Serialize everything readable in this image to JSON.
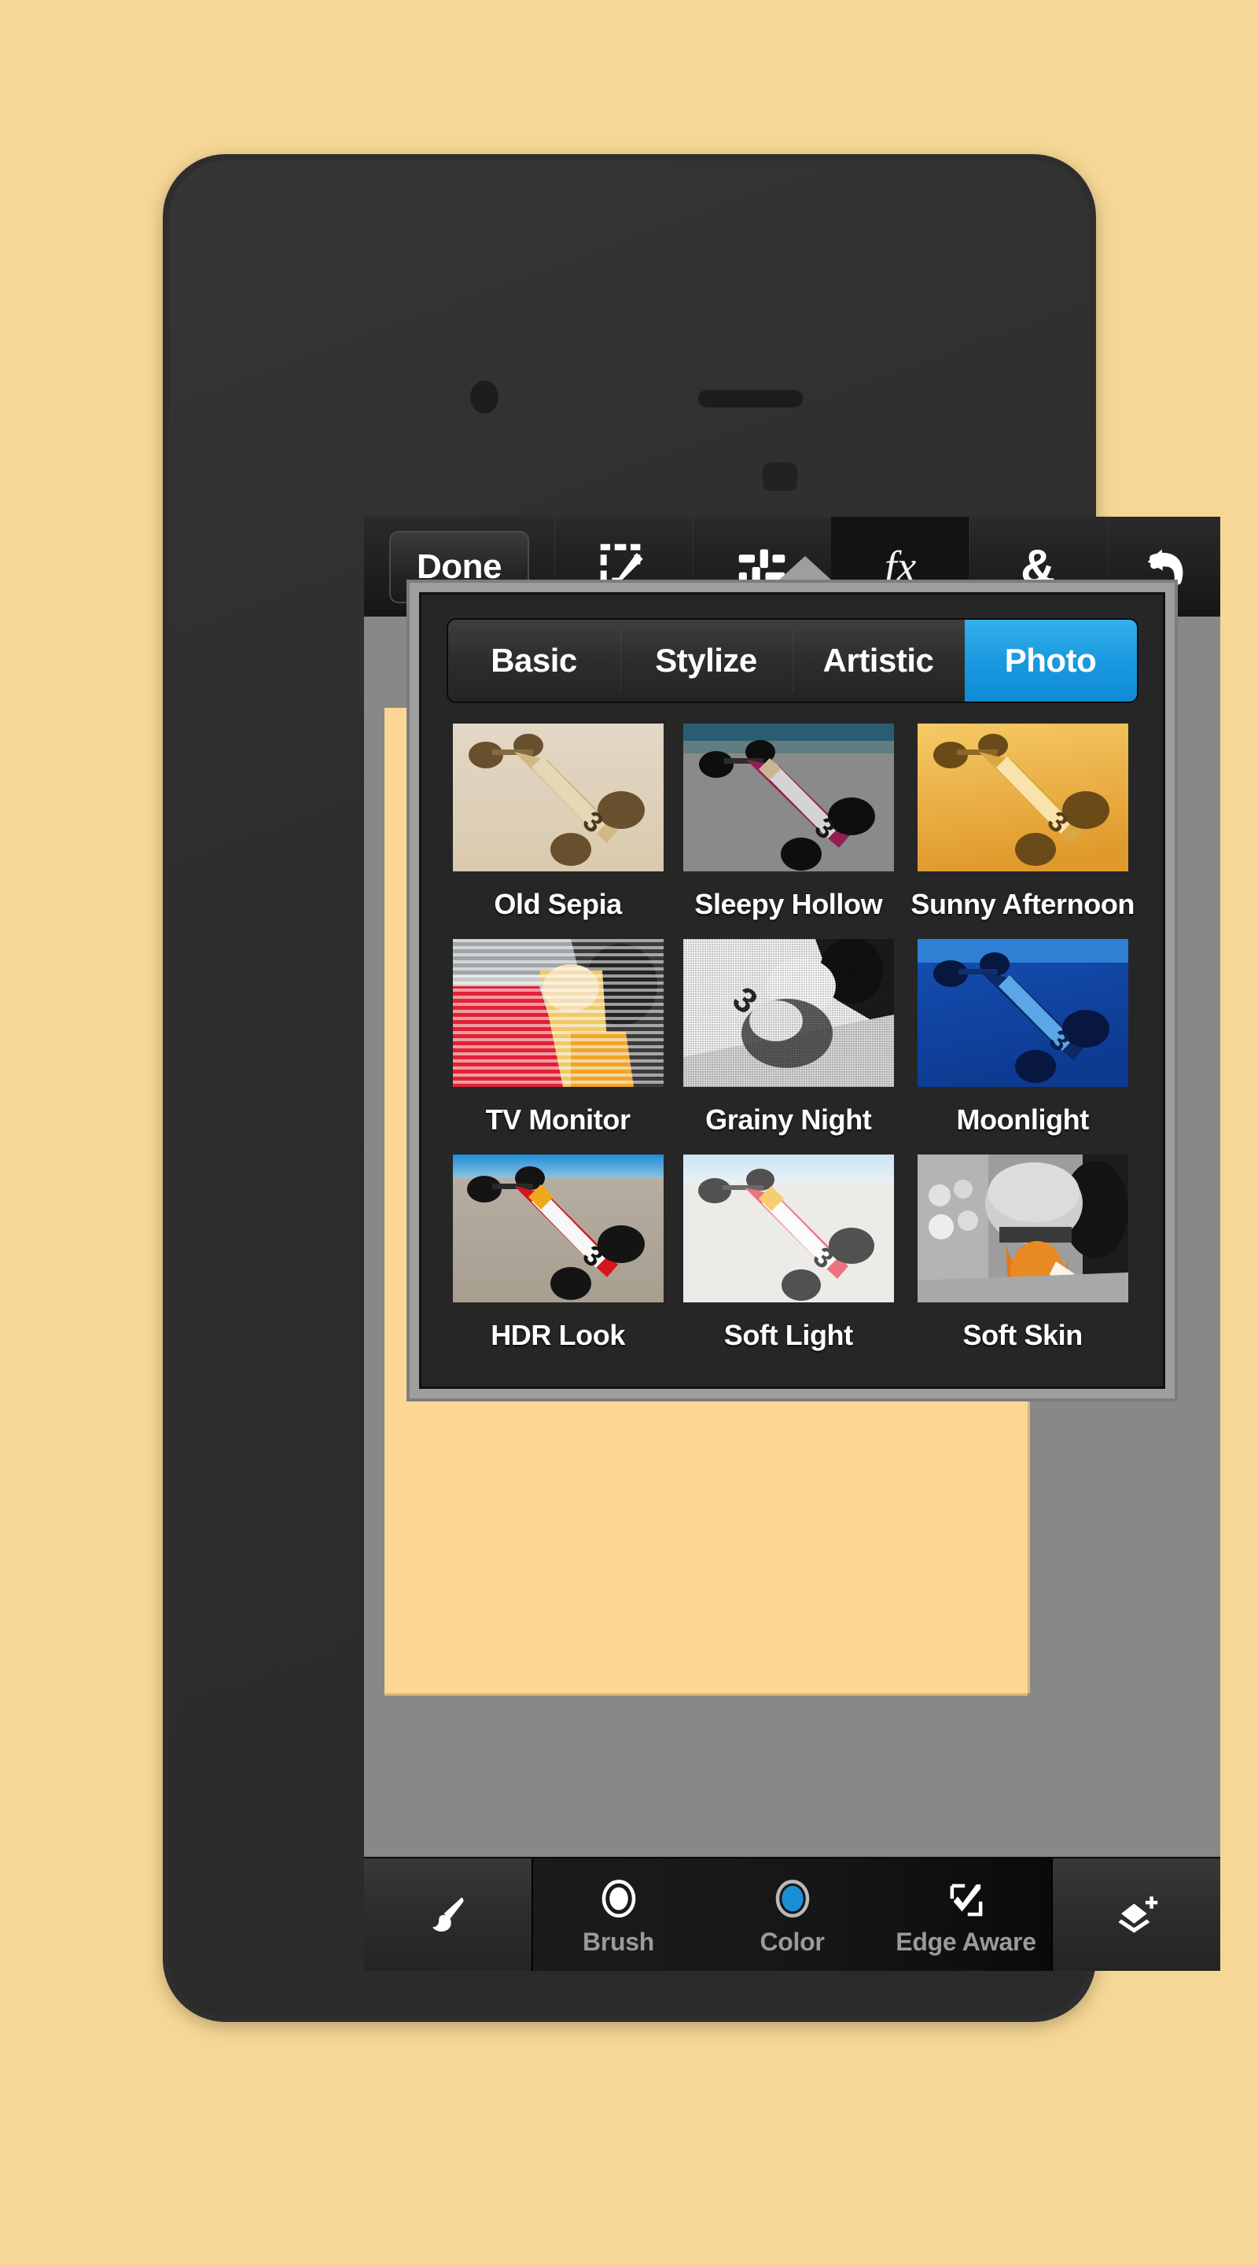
{
  "app": {
    "background_color": "#f6d795",
    "accent_color": "#1a9ae0",
    "canvas_color": "#fcd694",
    "workspace_color": "#888888"
  },
  "toolbar": {
    "done_label": "Done",
    "items": [
      {
        "name": "select-edit-icon",
        "icon": "marquee-pencil"
      },
      {
        "name": "adjust-icon",
        "icon": "sliders"
      },
      {
        "name": "effects-icon",
        "icon": "fx",
        "label": "fx",
        "active": true
      },
      {
        "name": "blend-icon",
        "icon": "ampersand",
        "label": "&"
      },
      {
        "name": "undo-icon",
        "icon": "undo-arrow"
      }
    ]
  },
  "fx_popup": {
    "tabs": [
      {
        "label": "Basic",
        "selected": false
      },
      {
        "label": "Stylize",
        "selected": false
      },
      {
        "label": "Artistic",
        "selected": false
      },
      {
        "label": "Photo",
        "selected": true
      }
    ],
    "effects": [
      {
        "label": "Old Sepia",
        "thumb": "sepia-racecar"
      },
      {
        "label": "Sleepy Hollow",
        "thumb": "magenta-racecar"
      },
      {
        "label": "Sunny Afternoon",
        "thumb": "orange-racecar"
      },
      {
        "label": "TV Monitor",
        "thumb": "scanline-racecar"
      },
      {
        "label": "Grainy Night",
        "thumb": "bw-grain-racecar"
      },
      {
        "label": "Moonlight",
        "thumb": "blue-racecar"
      },
      {
        "label": "HDR Look",
        "thumb": "hdr-racecar"
      },
      {
        "label": "Soft Light",
        "thumb": "soft-racecar"
      },
      {
        "label": "Soft Skin",
        "thumb": "bw-driver-portrait"
      }
    ]
  },
  "bottom_bar": {
    "left_tool": {
      "name": "brush-tool-icon",
      "icon": "paintbrush"
    },
    "options": [
      {
        "label": "Brush",
        "icon": "circle-outline"
      },
      {
        "label": "Color",
        "icon": "color-swatch",
        "color": "#1a8fd6"
      },
      {
        "label": "Edge Aware",
        "icon": "checkmark-square"
      }
    ],
    "right_tool": {
      "name": "add-layer-icon",
      "icon": "layers-plus"
    }
  }
}
